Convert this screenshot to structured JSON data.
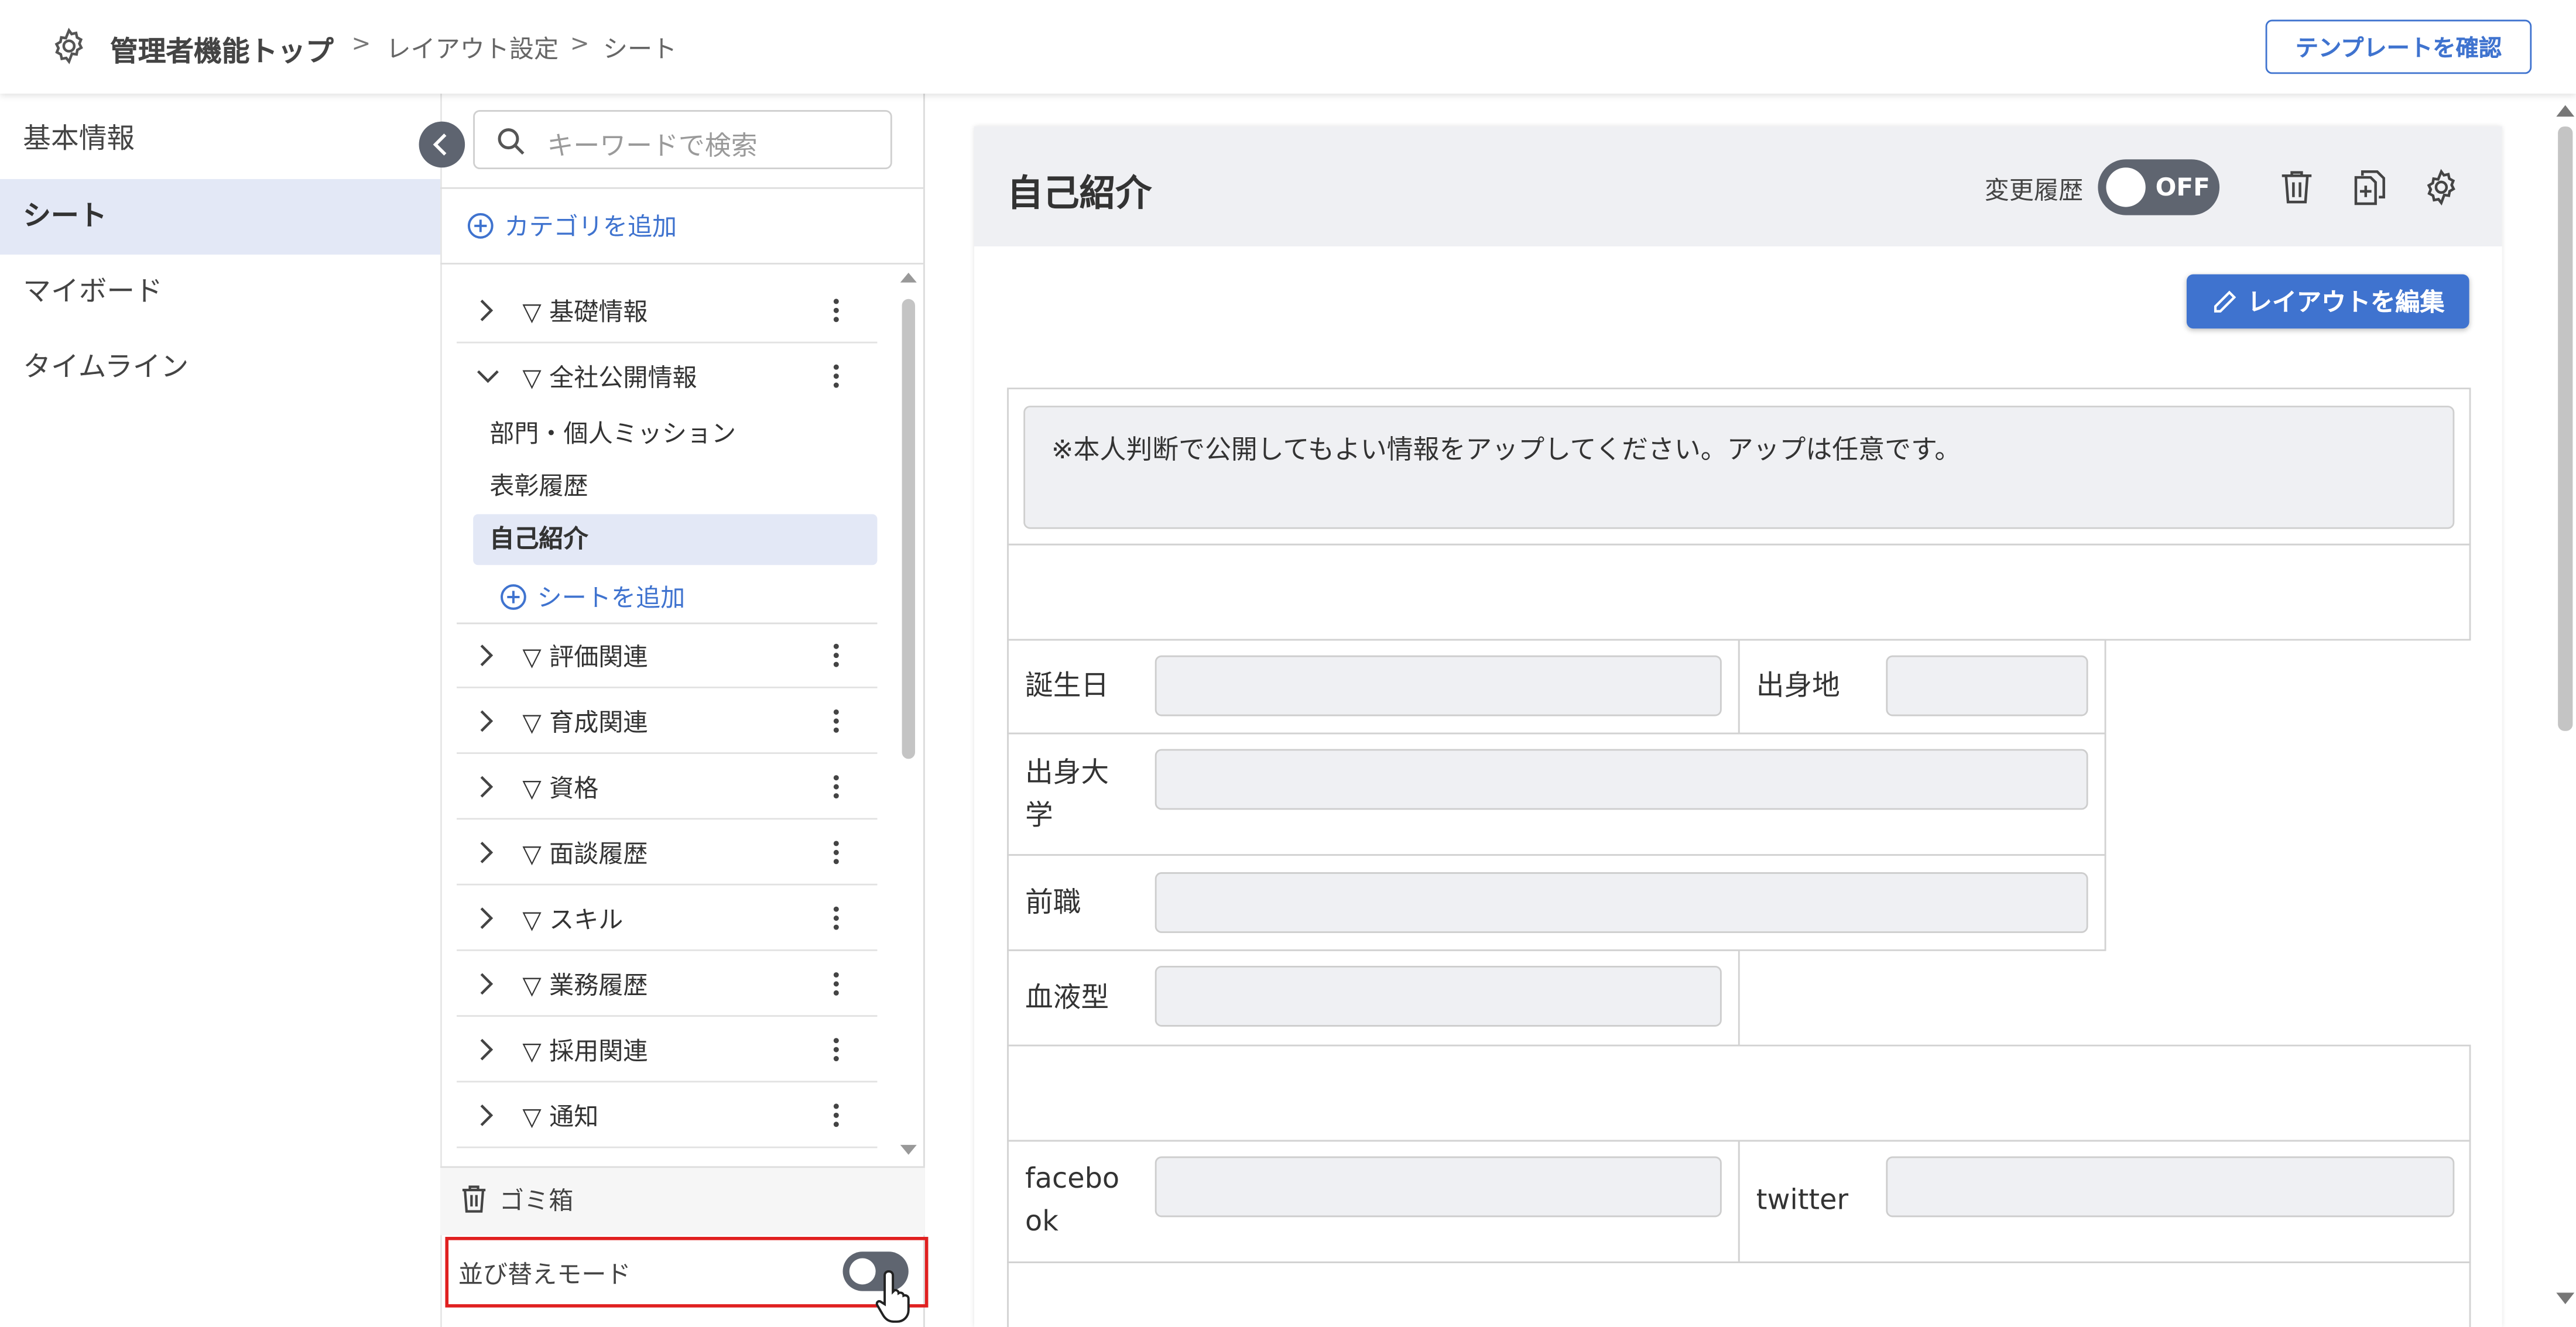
{
  "header": {
    "breadcrumb": [
      "管理者機能トップ",
      "レイアウト設定",
      "シート"
    ],
    "template_button": "テンプレートを確認"
  },
  "nav": {
    "items": [
      "基本情報",
      "シート",
      "マイボード",
      "タイムライン"
    ],
    "active": "シート"
  },
  "sidebar": {
    "search_placeholder": "キーワードで検索",
    "add_category": "カテゴリを追加",
    "categories": [
      {
        "label": "▽ 基礎情報",
        "expanded": false
      },
      {
        "label": "▽ 全社公開情報",
        "expanded": true
      },
      {
        "label": "▽ 評価関連",
        "expanded": false
      },
      {
        "label": "▽ 育成関連",
        "expanded": false
      },
      {
        "label": "▽ 資格",
        "expanded": false
      },
      {
        "label": "▽ 面談履歴",
        "expanded": false
      },
      {
        "label": "▽ スキル",
        "expanded": false
      },
      {
        "label": "▽ 業務履歴",
        "expanded": false
      },
      {
        "label": "▽ 採用関連",
        "expanded": false
      },
      {
        "label": "▽ 通知",
        "expanded": false
      }
    ],
    "sheets": [
      "部門・個人ミッション",
      "表彰履歴",
      "自己紹介"
    ],
    "active_sheet": "自己紹介",
    "add_sheet": "シートを追加",
    "trash": "ゴミ箱",
    "sort_mode": "並び替えモード",
    "sort_mode_on": false
  },
  "main": {
    "title": "自己紹介",
    "history_label": "変更履歴",
    "history_state": "OFF",
    "edit_layout_button": "レイアウトを編集",
    "notice": "※本人判断で公開してもよい情報をアップしてください。アップは任意です。",
    "fields": {
      "birthday": "誕生日",
      "birthplace": "出身地",
      "university_line1": "出身大",
      "university_line2": "学",
      "previous_job": "前職",
      "blood_type": "血液型",
      "facebook_line1": "facebo",
      "facebook_line2": "ok",
      "twitter": "twitter"
    }
  },
  "colors": {
    "accent": "#3f73cf",
    "active_bg": "#e3e8f6",
    "highlight_border": "#e02020",
    "toggle_bg": "#5f6570"
  }
}
